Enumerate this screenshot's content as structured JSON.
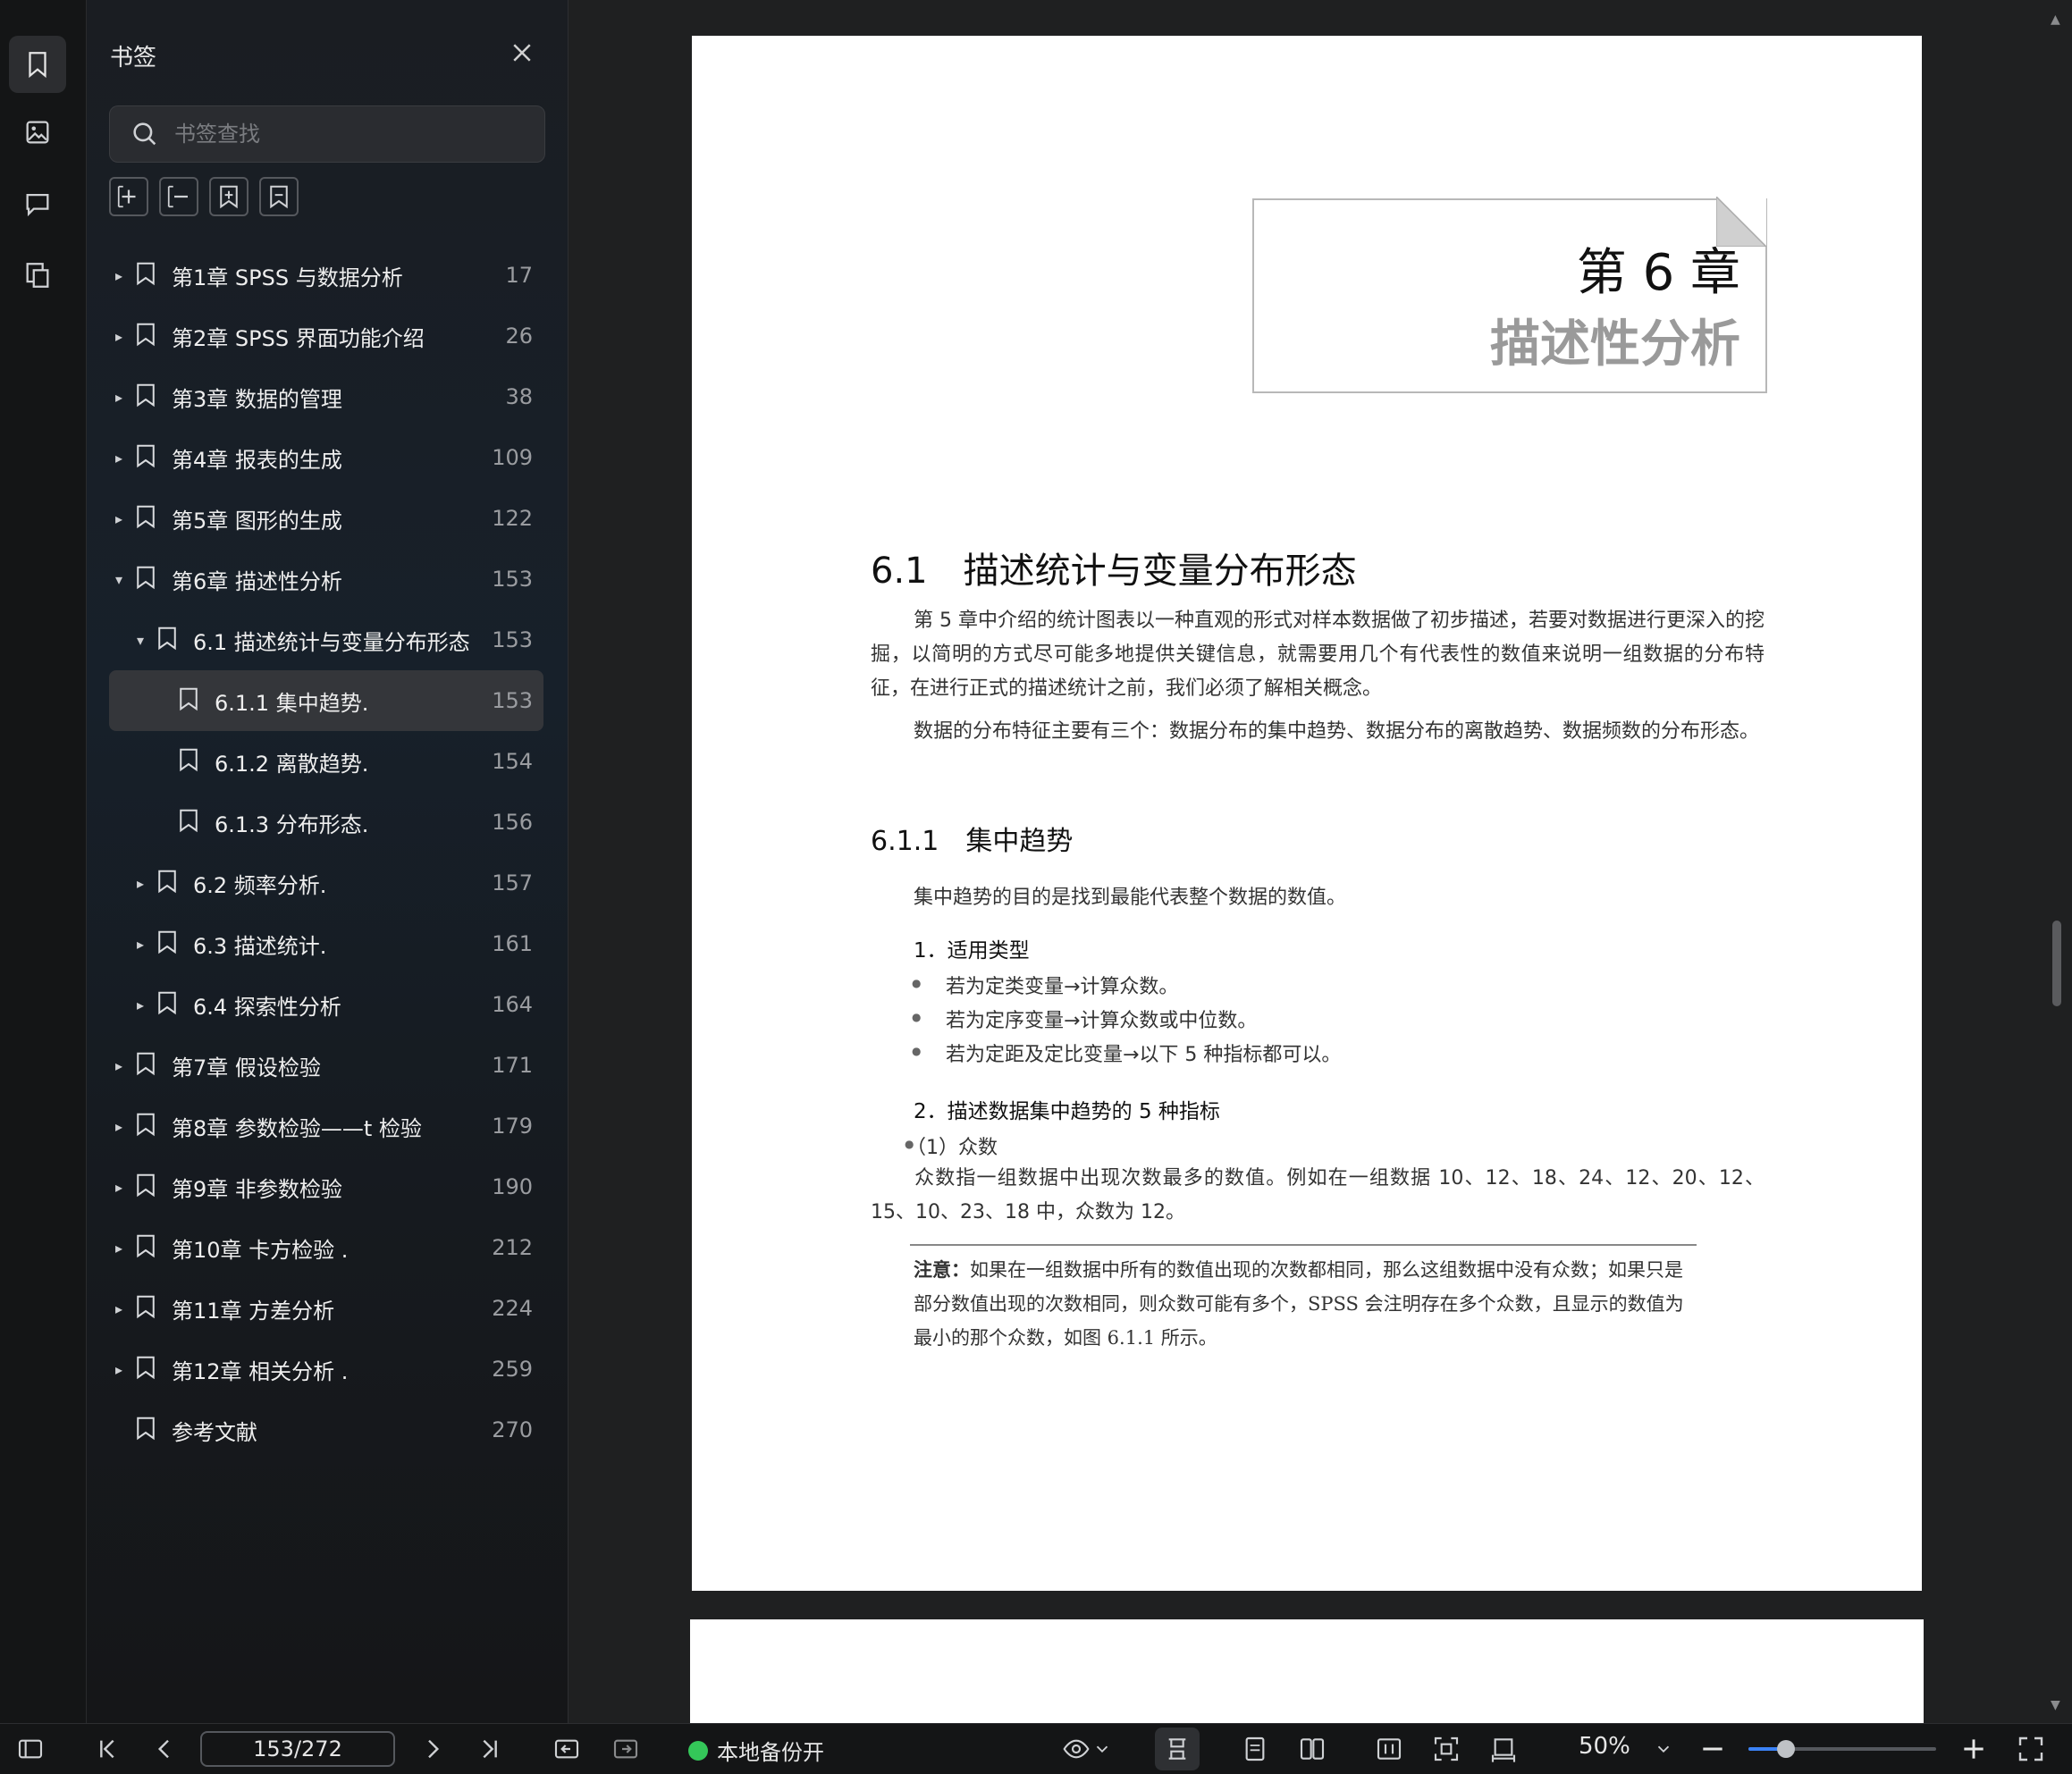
{
  "sidebar": {
    "title": "书签",
    "search_placeholder": "书签查找",
    "items": [
      {
        "label": "第1章 SPSS 与数据分析",
        "page": "17",
        "level": 0,
        "caret": "▸"
      },
      {
        "label": "第2章 SPSS 界面功能介绍",
        "page": "26",
        "level": 0,
        "caret": "▸"
      },
      {
        "label": "第3章 数据的管理",
        "page": "38",
        "level": 0,
        "caret": "▸"
      },
      {
        "label": "第4章 报表的生成",
        "page": "109",
        "level": 0,
        "caret": "▸"
      },
      {
        "label": "第5章 图形的生成",
        "page": "122",
        "level": 0,
        "caret": "▸"
      },
      {
        "label": "第6章 描述性分析",
        "page": "153",
        "level": 0,
        "caret": "▾"
      },
      {
        "label": "6.1 描述统计与变量分布形态",
        "page": "153",
        "level": 1,
        "caret": "▾"
      },
      {
        "label": "6.1.1 集中趋势.",
        "page": "153",
        "level": 2,
        "caret": "",
        "selected": true
      },
      {
        "label": "6.1.2 离散趋势.",
        "page": "154",
        "level": 2,
        "caret": ""
      },
      {
        "label": "6.1.3 分布形态.",
        "page": "156",
        "level": 2,
        "caret": ""
      },
      {
        "label": "6.2 频率分析.",
        "page": "157",
        "level": 1,
        "caret": "▸"
      },
      {
        "label": "6.3 描述统计.",
        "page": "161",
        "level": 1,
        "caret": "▸"
      },
      {
        "label": "6.4 探索性分析",
        "page": "164",
        "level": 1,
        "caret": "▸"
      },
      {
        "label": "第7章 假设检验",
        "page": "171",
        "level": 0,
        "caret": "▸"
      },
      {
        "label": "第8章 参数检验——t 检验",
        "page": "179",
        "level": 0,
        "caret": "▸"
      },
      {
        "label": "第9章 非参数检验",
        "page": "190",
        "level": 0,
        "caret": "▸"
      },
      {
        "label": "第10章 卡方检验 .",
        "page": "212",
        "level": 0,
        "caret": "▸"
      },
      {
        "label": "第11章 方差分析",
        "page": "224",
        "level": 0,
        "caret": "▸"
      },
      {
        "label": "第12章 相关分析 .",
        "page": "259",
        "level": 0,
        "caret": "▸"
      },
      {
        "label": "参考文献",
        "page": "270",
        "level": 0,
        "caret": ""
      }
    ]
  },
  "doc": {
    "chapter_no": "第 6 章",
    "chapter_name": "描述性分析",
    "h1": "6.1　描述统计与变量分布形态",
    "p1": "第 5 章中介绍的统计图表以一种直观的形式对样本数据做了初步描述，若要对数据进行更深入的挖掘，以简明的方式尽可能多地提供关键信息，就需要用几个有代表性的数值来说明一组数据的分布特征，在进行正式的描述统计之前，我们必须了解相关概念。",
    "p2": "数据的分布特征主要有三个：数据分布的集中趋势、数据分布的离散趋势、数据频数的分布形态。",
    "h2": "6.1.1　集中趋势",
    "p3": "集中趋势的目的是找到最能代表整个数据的数值。",
    "sub1": "1．适用类型",
    "bullets": [
      "若为定类变量→计算众数。",
      "若为定序变量→计算众数或中位数。",
      "若为定距及定比变量→以下 5 种指标都可以。"
    ],
    "sub2": "2．描述数据集中趋势的 5 种指标",
    "sub3": "（1）众数",
    "p4": "众数指一组数据中出现次数最多的数值。例如在一组数据 10、12、18、24、12、20、12、15、10、23、18 中，众数为 12。",
    "note_label": "注意：",
    "note": "如果在一组数据中所有的数值出现的次数都相同，那么这组数据中没有众数；如果只是部分数值出现的次数相同，则众数可能有多个，SPSS 会注明存在多个众数，且显示的数值为最小的那个众数，如图 6.1.1 所示。"
  },
  "statusbar": {
    "page_indicator": "153/272",
    "backup_label": "本地备份开",
    "zoom": "50%",
    "zoom_level": 0.2
  },
  "colors": {
    "accent": "#3b82f6",
    "backup_dot": "#34c759",
    "selected_row": "#34363a"
  }
}
